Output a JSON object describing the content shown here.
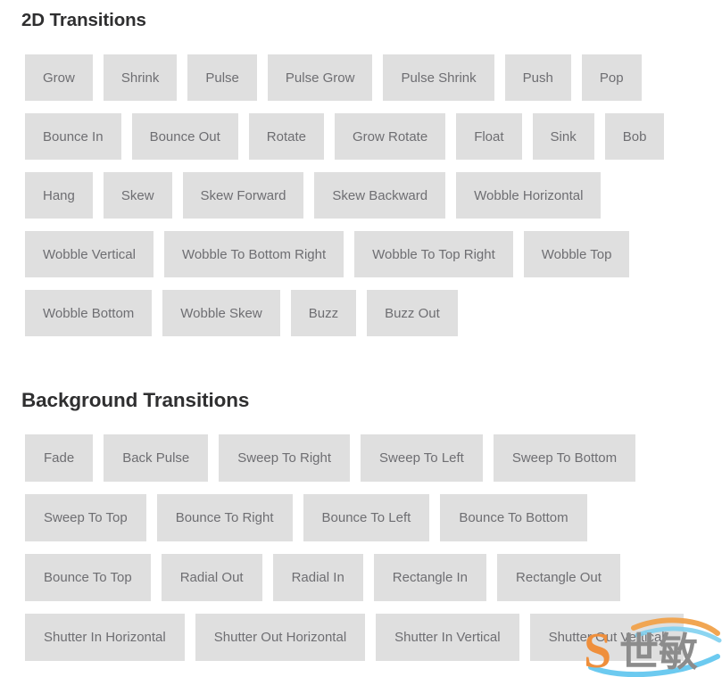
{
  "page": {
    "background_color": "#ffffff",
    "button_bg_color": "#dfdfdf",
    "button_text_color": "#6e6e72",
    "heading_color": "#2f2f30"
  },
  "sections": [
    {
      "id": "2d",
      "heading": "2D Transitions",
      "rows": [
        [
          "Grow",
          "Shrink",
          "Pulse",
          "Pulse Grow",
          "Pulse Shrink",
          "Push",
          "Pop"
        ],
        [
          "Bounce In",
          "Bounce Out",
          "Rotate",
          "Grow Rotate",
          "Float",
          "Sink",
          "Bob"
        ],
        [
          "Hang",
          "Skew",
          "Skew Forward",
          "Skew Backward",
          "Wobble Horizontal"
        ],
        [
          "Wobble Vertical",
          "Wobble To Bottom Right",
          "Wobble To Top Right",
          "Wobble Top"
        ],
        [
          "Wobble Bottom",
          "Wobble Skew",
          "Buzz",
          "Buzz Out"
        ]
      ]
    },
    {
      "id": "background",
      "heading": "Background Transitions",
      "rows": [
        [
          "Fade",
          "Back Pulse",
          "Sweep To Right",
          "Sweep To Left",
          "Sweep To Bottom"
        ],
        [
          "Sweep To Top",
          "Bounce To Right",
          "Bounce To Left",
          "Bounce To Bottom"
        ],
        [
          "Bounce To Top",
          "Radial Out",
          "Radial In",
          "Rectangle In",
          "Rectangle Out"
        ],
        [
          "Shutter In Horizontal",
          "Shutter Out Horizontal",
          "Shutter In Vertical",
          "Shutter Out Vertical"
        ]
      ]
    }
  ],
  "watermark": {
    "letter": "S",
    "characters": "世敏",
    "letter_color": "#ef8f3c",
    "characters_color": "#8c8c8c",
    "arc_top_color": "#f0a14a",
    "arc_bottom_color": "#5cc4ee"
  }
}
